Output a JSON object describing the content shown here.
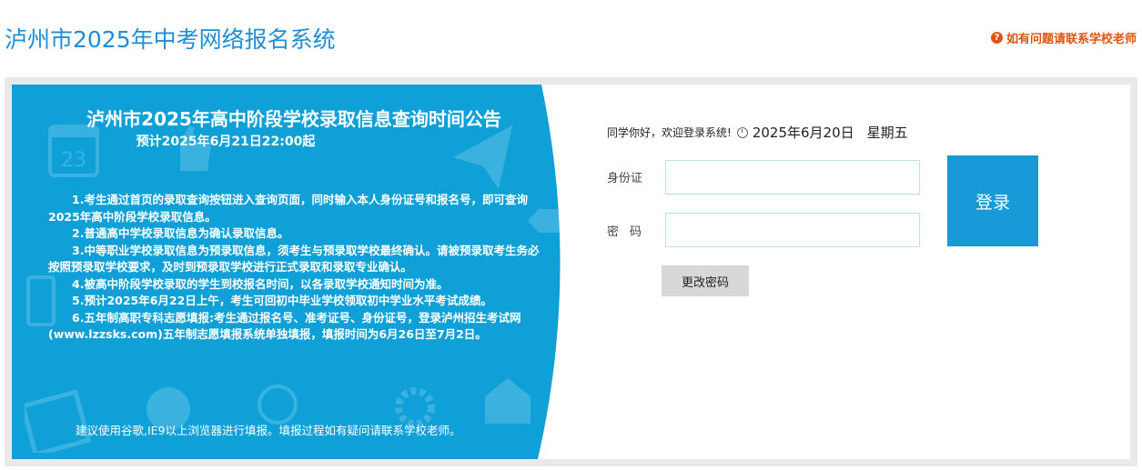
{
  "header": {
    "title": "泸州市2025年中考网络报名系统",
    "help_link": "如有问题请联系学校老师",
    "help_icon": "question-circle-icon",
    "accent_color": "#1e8fd6",
    "help_color": "#e0530a"
  },
  "notice": {
    "title": "泸州市2025年高中阶段学校录取信息查询时间公告",
    "subtitle": "预计2025年6月21日22:00起",
    "bg_color": "#0fa0d8",
    "paragraphs": [
      "1.考生通过首页的录取查询按钮进入查询页面，同时输入本人身份证号和报名号，即可查询2025年高中阶段学校录取信息。",
      "2.普通高中学校录取信息为确认录取信息。",
      "3.中等职业学校录取信息为预录取信息，须考生与预录取学校最终确认。请被预录取考生务必按照预录取学校要求，及时到预录取学校进行正式录取和录取专业确认。",
      "4.被高中阶段学校录取的学生到校报名时间，以各录取学校通知时间为准。",
      "5.预计2025年6月22日上午，考生可回初中毕业学校领取初中学业水平考试成绩。",
      "6.五年制高职专科志愿填报:考生通过报名号、准考证号、身份证号，登录泸州招生考试网(www.lzzsks.com)五年制志愿填报系统单独填报，填报时间为6月26日至7月2日。"
    ],
    "footer": "建议使用谷歌,IE9以上浏览器进行填报。填报过程如有疑问请联系学校老师。"
  },
  "login": {
    "welcome": "同学你好，欢迎登录系统!",
    "date": "2025年6月20日",
    "weekday": "星期五",
    "id_label": "身份证",
    "password_label": "密码",
    "id_value": "",
    "password_value": "",
    "login_button": "登录",
    "change_password_button": "更改密码",
    "button_color": "#1a99d8"
  }
}
